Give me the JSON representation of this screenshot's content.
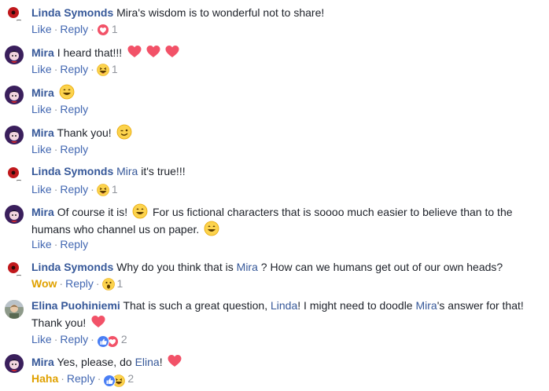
{
  "comments": [
    {
      "author": "Linda Symonds",
      "avatar_icon": "linda-avatar",
      "text1": "Mira's wisdom is to wonderful not to share!",
      "actions": {
        "like": "Like",
        "reply": "Reply",
        "reaction_icon": "love-reaction-icon",
        "count": "1"
      }
    },
    {
      "author": "Mira",
      "avatar_icon": "mira-avatar",
      "text1": "I heard that!!!",
      "actions": {
        "like": "Like",
        "reply": "Reply",
        "reaction_icon": "haha-reaction-icon",
        "count": "1"
      }
    },
    {
      "author": "Mira",
      "avatar_icon": "mira-avatar",
      "actions": {
        "like": "Like",
        "reply": "Reply"
      }
    },
    {
      "author": "Mira",
      "avatar_icon": "mira-avatar",
      "text1": "Thank you!",
      "actions": {
        "like": "Like",
        "reply": "Reply"
      }
    },
    {
      "author": "Linda Symonds",
      "avatar_icon": "linda-avatar",
      "mention": "Mira",
      "text1": "it's true!!!",
      "actions": {
        "like": "Like",
        "reply": "Reply",
        "reaction_icon": "haha-reaction-icon",
        "count": "1"
      }
    },
    {
      "author": "Mira",
      "avatar_icon": "mira-avatar",
      "text1": "Of course it is!",
      "text2": "For us fictional characters that is soooo much easier to believe than to the",
      "text3": "humans who channel us on paper.",
      "actions": {
        "like": "Like",
        "reply": "Reply"
      }
    },
    {
      "author": "Linda Symonds",
      "avatar_icon": "linda-avatar",
      "text1": "Why do you think that is",
      "mention": "Mira",
      "text2": "? How can we humans get out of our own heads?",
      "actions": {
        "like": "Wow",
        "reply": "Reply",
        "reaction_icon": "wow-reaction-icon",
        "count": "1"
      }
    },
    {
      "author": "Elina Puohiniemi",
      "avatar_icon": "elina-avatar",
      "text1": "That is such a great question,",
      "mention1": "Linda",
      "text2": "! I might need to doodle",
      "mention2": "Mira",
      "text3": "'s answer for that!",
      "text4": "Thank you!",
      "actions": {
        "like": "Like",
        "reply": "Reply",
        "reaction_icon": "like-love-reaction-icon",
        "count": "2"
      }
    },
    {
      "author": "Mira",
      "avatar_icon": "mira-avatar",
      "text1": "Yes, please, do",
      "mention": "Elina",
      "text2": "!",
      "actions": {
        "like": "Haha",
        "reply": "Reply",
        "reaction_icon": "like-haha-reaction-icon",
        "count": "2"
      }
    }
  ],
  "colors": {
    "name": "#365899",
    "link": "#4267b2",
    "meta": "#90949c",
    "wow": "#e0a100",
    "heart": "#f25268"
  }
}
